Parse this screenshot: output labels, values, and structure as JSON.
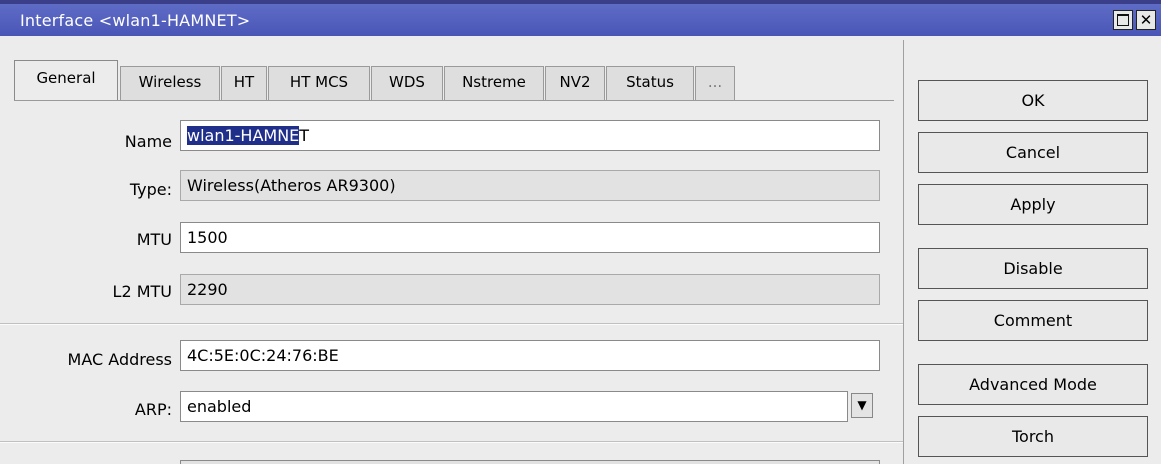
{
  "window": {
    "title": "Interface <wlan1-HAMNET>",
    "close_glyph": "✕",
    "colors": {
      "titlebar": "#5561bf",
      "selection": "#1f2f8a",
      "readonly_field": "#e2e2e2"
    }
  },
  "tabs": [
    {
      "label": "General",
      "active": true
    },
    {
      "label": "Wireless"
    },
    {
      "label": "HT"
    },
    {
      "label": "HT MCS"
    },
    {
      "label": "WDS"
    },
    {
      "label": "Nstreme"
    },
    {
      "label": "NV2"
    },
    {
      "label": "Status"
    },
    {
      "label": "..."
    }
  ],
  "form": {
    "name": {
      "label": "Name",
      "value_selected": "wlan1-HAMNE",
      "value_rest": "T"
    },
    "type": {
      "label": "Type:",
      "value": "Wireless(Atheros AR9300)"
    },
    "mtu": {
      "label": "MTU",
      "value": "1500"
    },
    "l2mtu": {
      "label": "L2 MTU",
      "value": "2290"
    },
    "mac": {
      "label": "MAC Address",
      "value": "4C:5E:0C:24:76:BE"
    },
    "arp": {
      "label": "ARP:",
      "value": "enabled",
      "dropdown_icon": "▼"
    }
  },
  "buttons": {
    "ok": "OK",
    "cancel": "Cancel",
    "apply": "Apply",
    "disable": "Disable",
    "comment": "Comment",
    "advanced_mode": "Advanced Mode",
    "torch": "Torch"
  }
}
